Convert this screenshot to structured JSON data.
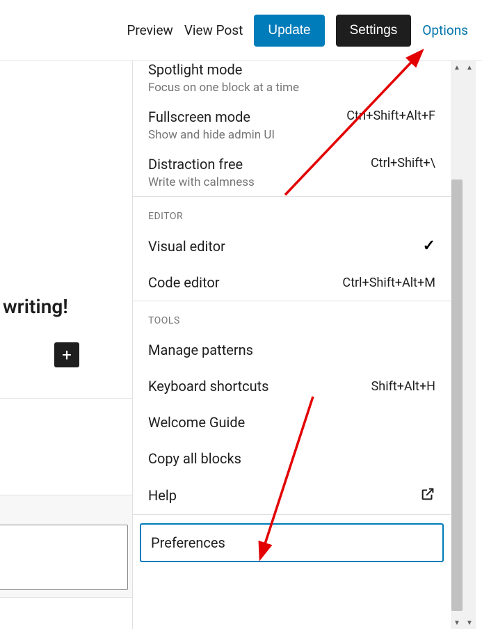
{
  "toolbar": {
    "preview": "Preview",
    "view_post": "View Post",
    "update": "Update",
    "settings": "Settings",
    "options": "Options"
  },
  "editor": {
    "partial_text": "writing!",
    "add_block": "+"
  },
  "menu": {
    "view_section": {
      "spotlight": {
        "label": "Spotlight mode",
        "desc": "Focus on one block at a time"
      },
      "fullscreen": {
        "label": "Fullscreen mode",
        "desc": "Show and hide admin UI",
        "shortcut": "Ctrl+Shift+Alt+F"
      },
      "distraction": {
        "label": "Distraction free",
        "desc": "Write with calmness",
        "shortcut": "Ctrl+Shift+\\"
      }
    },
    "editor_section": {
      "heading": "Editor",
      "visual": {
        "label": "Visual editor"
      },
      "code": {
        "label": "Code editor",
        "shortcut": "Ctrl+Shift+Alt+M"
      }
    },
    "tools_section": {
      "heading": "Tools",
      "manage": {
        "label": "Manage patterns"
      },
      "shortcuts": {
        "label": "Keyboard shortcuts",
        "shortcut": "Shift+Alt+H"
      },
      "welcome": {
        "label": "Welcome Guide"
      },
      "copy": {
        "label": "Copy all blocks"
      },
      "help": {
        "label": "Help"
      }
    },
    "preferences": {
      "label": "Preferences"
    }
  }
}
